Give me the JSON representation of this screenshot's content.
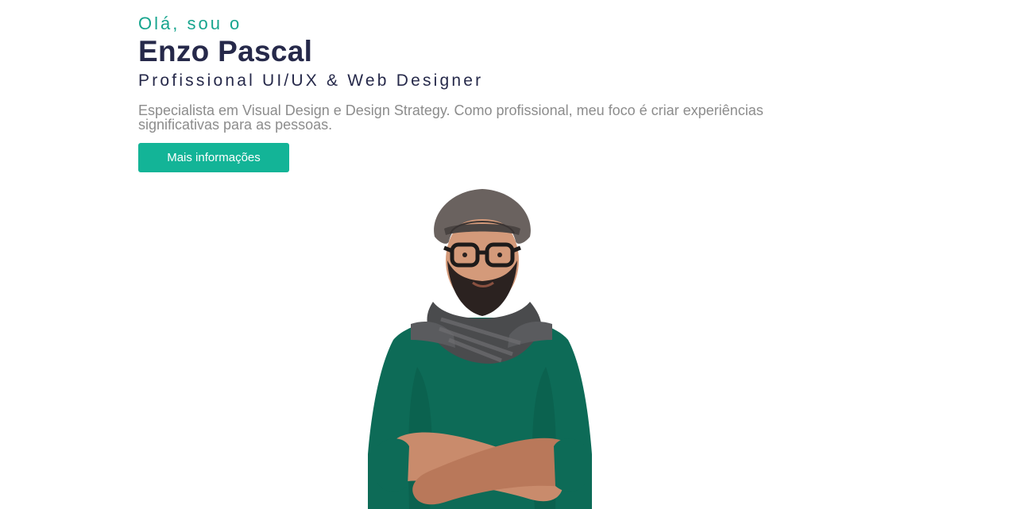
{
  "hero": {
    "greeting": "Olá, sou o",
    "name": "Enzo Pascal",
    "role": "Profissional UI/UX & Web Designer",
    "description": "Especialista em Visual Design e Design Strategy. Como profissional, meu foco é criar experiências significativas para as pessoas.",
    "cta_label": "Mais informações"
  },
  "colors": {
    "accent": "#13b497",
    "heading": "#26294a",
    "body_text": "#8c8c8c",
    "background": "#ffffff"
  },
  "photo": {
    "subject": "man with hat, glasses, beard, scarf and green sweater with crossed arms"
  }
}
